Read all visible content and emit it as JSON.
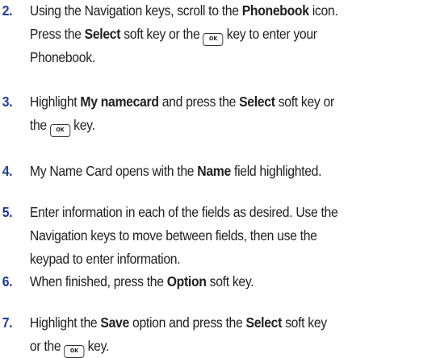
{
  "steps": [
    {
      "number": "2.",
      "lines": [
        [
          {
            "t": "Using the Navigation keys, scroll to the "
          },
          {
            "t": "Phonebook",
            "b": true
          },
          {
            "t": " icon."
          }
        ],
        [
          {
            "t": "Press the "
          },
          {
            "t": "Select",
            "b": true
          },
          {
            "t": " soft key or the "
          },
          {
            "key": "OK"
          },
          {
            "t": " key to enter your"
          }
        ],
        [
          {
            "t": "Phonebook."
          }
        ]
      ]
    },
    {
      "number": "3.",
      "lines": [
        [
          {
            "t": "Highlight "
          },
          {
            "t": "My namecard",
            "b": true
          },
          {
            "t": " and press the "
          },
          {
            "t": "Select",
            "b": true
          },
          {
            "t": " soft key or"
          }
        ],
        [
          {
            "t": "the "
          },
          {
            "key": "OK"
          },
          {
            "t": " key."
          }
        ]
      ]
    },
    {
      "number": "4.",
      "lines": [
        [
          {
            "t": "My Name Card opens with the "
          },
          {
            "t": "Name",
            "b": true
          },
          {
            "t": " field highlighted."
          }
        ]
      ]
    },
    {
      "number": "5.",
      "lines": [
        [
          {
            "t": "Enter information in each of the fields as desired. Use the"
          }
        ],
        [
          {
            "t": "Navigation keys to move between fields, then use the"
          }
        ],
        [
          {
            "t": "keypad to enter information."
          }
        ]
      ]
    },
    {
      "number": "6.",
      "lines": [
        [
          {
            "t": "When finished, press the "
          },
          {
            "t": "Option",
            "b": true
          },
          {
            "t": " soft key."
          }
        ]
      ]
    },
    {
      "number": "7.",
      "lines": [
        [
          {
            "t": "Highlight the "
          },
          {
            "t": "Save",
            "b": true
          },
          {
            "t": " option and press the "
          },
          {
            "t": "Select",
            "b": true
          },
          {
            "t": " soft key"
          }
        ],
        [
          {
            "t": "or the "
          },
          {
            "key": "OK"
          },
          {
            "t": " key."
          }
        ]
      ]
    }
  ]
}
